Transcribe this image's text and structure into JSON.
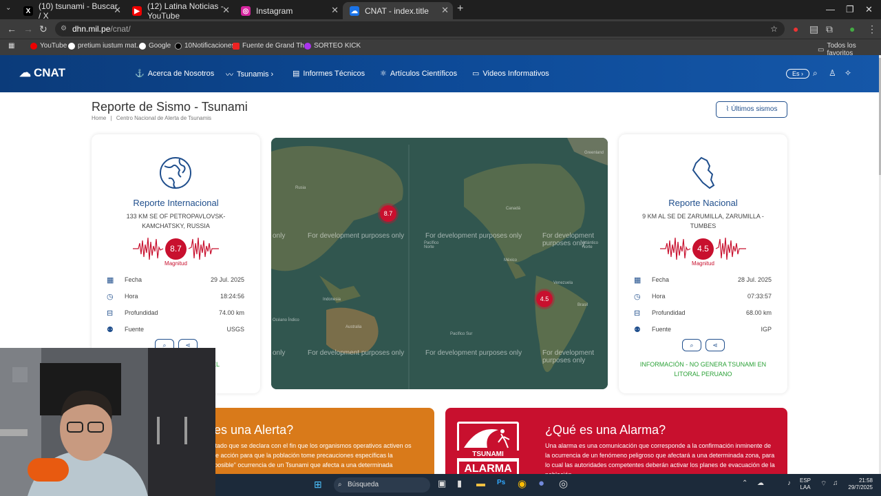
{
  "browser": {
    "tabs": [
      {
        "label": "(10) tsunami - Buscar / X",
        "icon": "x-logo-icon",
        "active": false
      },
      {
        "label": "(12) Latina Noticias - YouTube",
        "icon": "youtube-icon",
        "active": false
      },
      {
        "label": "Instagram",
        "icon": "instagram-icon",
        "active": false
      },
      {
        "label": "CNAT - index.title",
        "icon": "cnat-icon",
        "active": true
      }
    ],
    "url_host": "dhn.mil.pe",
    "url_path": "/cnat/",
    "bookmarks": [
      "YouTube",
      "pretium iustum mat...",
      "Google",
      "10Notificaciones",
      "Fuente de Grand Th...",
      "SORTEO KICK"
    ],
    "all_favorites": "Todos los favoritos"
  },
  "site": {
    "logo": "CNAT",
    "nav": [
      "Acerca de Nosotros",
      "Tsunamis ›",
      "Informes Técnicos",
      "Artículos Científicos",
      "Videos Informativos"
    ],
    "lang": "Es ›"
  },
  "page": {
    "title": "Reporte de Sismo - Tsunami",
    "breadcrumb_home": "Home",
    "breadcrumb_sep": "|",
    "breadcrumb_current": "Centro Nacional de Alerta de Tsunamis",
    "last_button": "Últimos sismos"
  },
  "international": {
    "title": "Reporte Internacional",
    "location": "133 KM SE OF PETROPAVLOVSK-KAMCHATSKY, RUSSIA",
    "magnitude": "8.7",
    "magnitude_label": "Magnitud",
    "rows": [
      {
        "label": "Fecha",
        "value": "29 Jul. 2025"
      },
      {
        "label": "Hora",
        "value": "18:24:56"
      },
      {
        "label": "Profundidad",
        "value": "74.00 km"
      },
      {
        "label": "Fuente",
        "value": "USGS"
      }
    ],
    "info_partial": "EN EL"
  },
  "national": {
    "title": "Reporte Nacional",
    "location": "9 KM AL SE DE ZARUMILLA, ZARUMILLA - TUMBES",
    "magnitude": "4.5",
    "magnitude_label": "Magnitud",
    "rows": [
      {
        "label": "Fecha",
        "value": "28 Jul. 2025"
      },
      {
        "label": "Hora",
        "value": "07:33:57"
      },
      {
        "label": "Profundidad",
        "value": "68.00 km"
      },
      {
        "label": "Fuente",
        "value": "IGP"
      }
    ],
    "info": "INFORMACIÓN - NO GENERA TSUNAMI EN LITORAL PERUANO"
  },
  "map": {
    "watermark": "For development purposes only",
    "watermark_short": "only",
    "markers": [
      "8.7",
      "4.5"
    ],
    "labels": [
      "Greenland",
      "Rusia",
      "Canadá",
      "México",
      "Venezuela",
      "Brasil",
      "Indonesia",
      "Australia",
      "Pacífico Sur",
      "Pacífico Norte",
      "Atlántico Norte",
      "Océano Índico"
    ]
  },
  "alerta": {
    "title": "é es una Alerta?",
    "text": "stado que se declara con el fin que los organismos operativos activen os de acción para que la población tome precauciones específicas la \"posible\" ocurrencia de un Tsunami que afecta a una determinada"
  },
  "alarma": {
    "title": "¿Qué es una Alarma?",
    "text": "Una alarma es una comunicación que corresponde a la confirmación inminente de la ocurrencia de un fenómeno peligroso que afectará a una determinada zona, para lo cual las autoridades competentes deberán activar los planes de evacuación de la población.",
    "badge_top": "TSUNAMI",
    "badge_bottom": "ALARMA"
  },
  "taskbar": {
    "search": "Búsqueda",
    "lang_top": "ESP",
    "lang_bottom": "LAA",
    "time": "21:58",
    "date": "29/7/2025"
  },
  "colors": {
    "brand": "#0d4a97",
    "accent": "#c8102e",
    "alerta": "#d97a1a",
    "info": "#2aa136"
  }
}
